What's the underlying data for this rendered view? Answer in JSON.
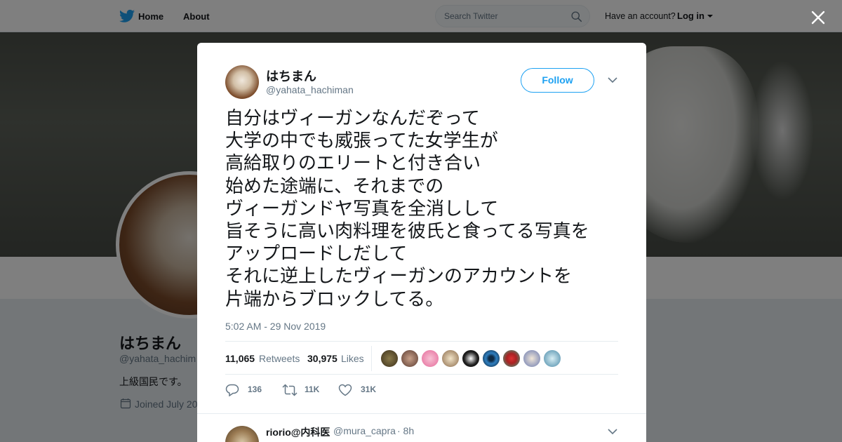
{
  "header": {
    "home_label": "Home",
    "about_label": "About",
    "search_placeholder": "Search Twitter",
    "have_account": "Have an account?",
    "login_label": "Log in"
  },
  "profile": {
    "name": "はちまん",
    "handle": "@yahata_hachim",
    "bio": "上級国民です。",
    "joined": "Joined July 20"
  },
  "tweet": {
    "author_name": "はちまん",
    "author_handle": "@yahata_hachiman",
    "follow_label": "Follow",
    "text": "自分はヴィーガンなんだぞって\n大学の中でも威張ってた女学生が\n高給取りのエリートと付き合い\n始めた途端に、それまでの\nヴィーガンドヤ写真を全消しして\n旨そうに高い肉料理を彼氏と食ってる写真を\nアップロードしだして\nそれに逆上したヴィーガンのアカウントを\n片端からブロックしてる。",
    "timestamp": "5:02 AM - 29 Nov 2019",
    "retweets_count": "11,065",
    "retweets_label": "Retweets",
    "likes_count": "30,975",
    "likes_label": "Likes",
    "reply_count": "136",
    "retweet_action_count": "11K",
    "like_action_count": "31K"
  },
  "reply": {
    "author_name": "riorio@内科医",
    "author_handle": "@mura_capra",
    "time": "· 8h"
  },
  "colors": {
    "accent": "#1da1f2",
    "secondary_text": "#657786"
  }
}
